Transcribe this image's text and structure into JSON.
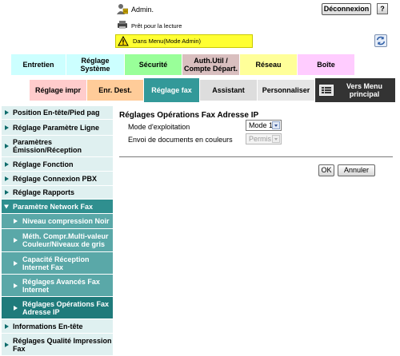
{
  "header": {
    "user_label": "Admin.",
    "logout_label": "Déconnexion",
    "help_label": "?",
    "status_text": "Prêt pour la lecture",
    "mode_text": "Dans Menu(Mode Admin)",
    "icons": [
      "user-icon",
      "printer-icon",
      "warning-icon",
      "refresh-icon"
    ]
  },
  "tabs_row1": [
    {
      "label": "Entretien",
      "color": "#ccffff"
    },
    {
      "label": "Réglage Système",
      "color": "#ccffff"
    },
    {
      "label": "Sécurité",
      "color": "#99ff99"
    },
    {
      "label": "Auth.Util / Compte Départ.",
      "color": "#d9bfbf"
    },
    {
      "label": "Réseau",
      "color": "#ffff99"
    },
    {
      "label": "Boîte",
      "color": "#ffccff"
    }
  ],
  "tabs_row2": [
    {
      "label": "Réglage impr",
      "color": "#ffcccc"
    },
    {
      "label": "Enr. Dest.",
      "color": "#ffcc99"
    },
    {
      "label": "Réglage fax",
      "color": "#339999",
      "active": true
    },
    {
      "label": "Assistant",
      "color": "#dddddd"
    },
    {
      "label": "Personnaliser",
      "color": "#e6e6e6"
    },
    {
      "label": "Vers Menu principal",
      "color": "#333333"
    }
  ],
  "sidebar": {
    "items": [
      {
        "label": "Position En-tête/Pied pag",
        "type": "top"
      },
      {
        "label": "Réglage Paramètre Ligne",
        "type": "top"
      },
      {
        "label": "Paramètres Émission/Réception",
        "type": "top"
      },
      {
        "label": "Réglage Fonction",
        "type": "top"
      },
      {
        "label": "Réglage Connexion PBX",
        "type": "top"
      },
      {
        "label": "Réglage Rapports",
        "type": "top"
      },
      {
        "label": "Paramètre Network Fax",
        "type": "open"
      },
      {
        "label": "Niveau compression Noir",
        "type": "sub"
      },
      {
        "label": "Méth. Compr.Multi-valeur Couleur/Niveaux de gris",
        "type": "sub"
      },
      {
        "label": "Capacité Réception Internet Fax",
        "type": "sub"
      },
      {
        "label": "Réglages Avancés Fax Internet",
        "type": "sub"
      },
      {
        "label": "Réglages Opérations Fax Adresse IP",
        "type": "sub-active"
      },
      {
        "label": "Informations En-tête",
        "type": "top"
      },
      {
        "label": "Réglages Qualité Impression Fax",
        "type": "top"
      }
    ]
  },
  "main": {
    "title": "Réglages Opérations Fax Adresse IP",
    "mode_label": "Mode d'exploitation",
    "mode_value": "Mode 1",
    "color_label": "Envoi de documents en couleurs",
    "color_value": "Permis",
    "ok_label": "OK",
    "cancel_label": "Annuler"
  }
}
